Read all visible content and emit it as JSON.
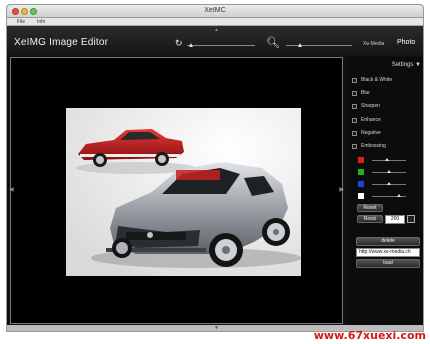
{
  "window": {
    "title": "XeIMC"
  },
  "menu": {
    "items": [
      "File",
      "Info"
    ]
  },
  "toolbar": {
    "app_title": "XeIMG Image Editor",
    "rotate_icon": "rotate-icon",
    "zoom_icon": "magnifier-icon",
    "brand_link": "Xe-Media",
    "photo_label": "Photo"
  },
  "panel": {
    "settings_label": "Settings",
    "settings_icon": "triangle-down-icon",
    "options": [
      {
        "label": "Black & White"
      },
      {
        "label": "Blur"
      },
      {
        "label": "Sharpen"
      },
      {
        "label": "Enhance"
      },
      {
        "label": "Negative"
      },
      {
        "label": "Embossing"
      }
    ],
    "color_channels": [
      {
        "name": "red",
        "color": "#e02020",
        "level": 0.45
      },
      {
        "name": "green",
        "color": "#22b022",
        "level": 0.5
      },
      {
        "name": "blue",
        "color": "#2040e0",
        "level": 0.5
      },
      {
        "name": "white",
        "color": "#ffffff",
        "level": 0.8
      }
    ],
    "reset_label": "Reset",
    "resize_label": "Resiz",
    "resize_value": "200",
    "delete_label": "delete",
    "url_value": "http://www.xe-media.ch",
    "load_label": "load"
  },
  "watermark": "www.67xuexi.com",
  "colors": {
    "background": "#101010",
    "panel": "#0c0c0c",
    "accent": "#e0e0e0"
  }
}
